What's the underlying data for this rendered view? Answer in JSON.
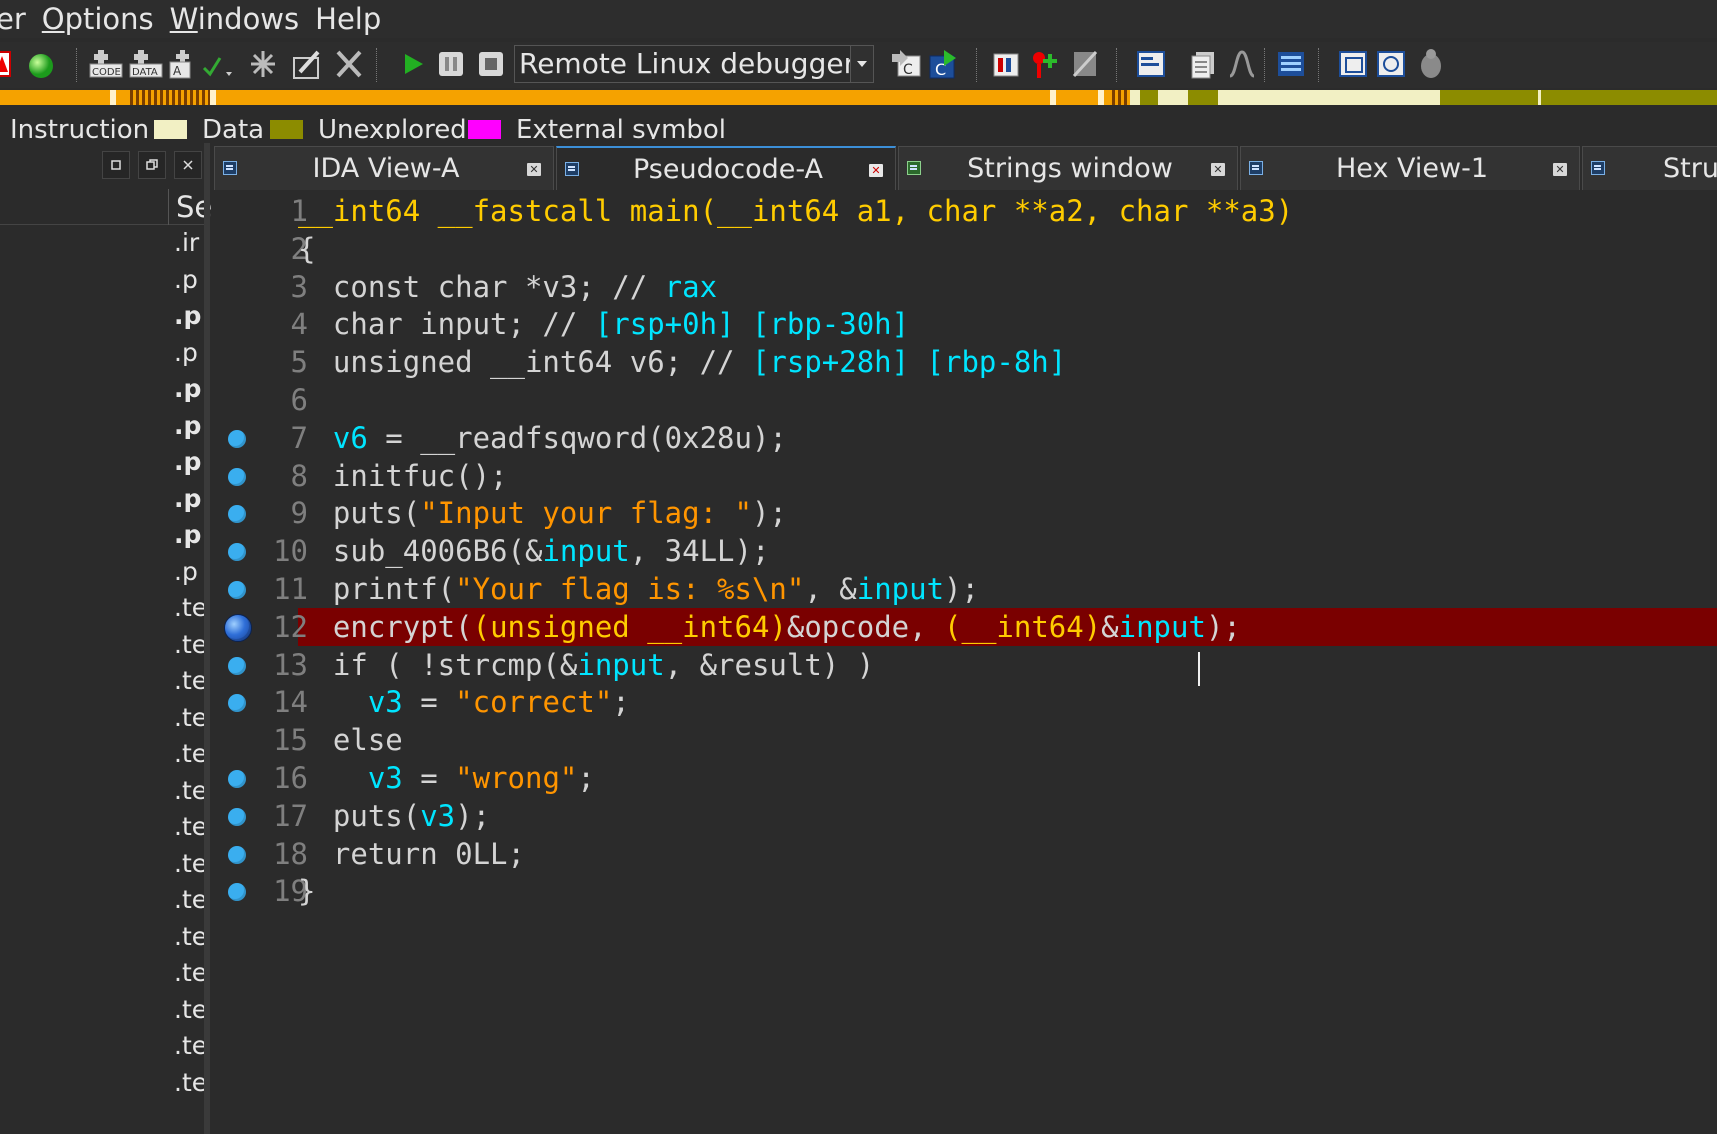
{
  "menu": [
    {
      "pre": "",
      "u": "",
      "post": "er"
    },
    {
      "pre": "",
      "u": "O",
      "post": "ptions"
    },
    {
      "pre": "",
      "u": "W",
      "post": "indows"
    },
    {
      "pre": "",
      "u": "",
      "post": "Help"
    }
  ],
  "toolbar": {
    "debugger_selected": "Remote Linux debugger"
  },
  "legend": {
    "items": [
      {
        "label": "Instruction",
        "color": ""
      },
      {
        "label": "Data",
        "color": "#f2f0c4"
      },
      {
        "label": "Unexplored",
        "color": "#8c8c00"
      },
      {
        "label": "External symbol",
        "color": "#ff00ff"
      }
    ]
  },
  "left_panel": {
    "column_header": "Se",
    "rows": [
      ".ir",
      ".p",
      ".p",
      ".p",
      ".p",
      ".p",
      ".p",
      ".p",
      ".p",
      ".p",
      ".te",
      ".te",
      ".te",
      ".te",
      ".te",
      ".te",
      ".te",
      ".te",
      ".te",
      ".te",
      ".te",
      ".te",
      ".te",
      ".te"
    ]
  },
  "tabs": [
    {
      "label": "IDA View-A",
      "active": false
    },
    {
      "label": "Pseudocode-A",
      "active": true
    },
    {
      "label": "Strings window",
      "active": false
    },
    {
      "label": "Hex View-1",
      "active": false
    },
    {
      "label": "Stru",
      "active": false
    }
  ],
  "colors": {
    "keyword": "#ffcc00",
    "variable": "#00e5ff",
    "string": "#ff9500",
    "highlight_line": "#7a0000",
    "breakpoint": "#3aaeef"
  },
  "code": {
    "current_line": 12,
    "lines": [
      {
        "n": "1",
        "bp": false,
        "tokens": [
          [
            "kw",
            "__int64 __fastcall main(__int64 a1, char **a2, char **a3)"
          ]
        ]
      },
      {
        "n": "2",
        "bp": false,
        "tokens": [
          [
            "plain",
            "{"
          ]
        ]
      },
      {
        "n": "3",
        "bp": false,
        "tokens": [
          [
            "plain",
            "  const char *v3; // "
          ],
          [
            "var",
            "rax"
          ]
        ]
      },
      {
        "n": "4",
        "bp": false,
        "tokens": [
          [
            "plain",
            "  char input; // "
          ],
          [
            "var",
            "[rsp+0h] [rbp-30h]"
          ]
        ]
      },
      {
        "n": "5",
        "bp": false,
        "tokens": [
          [
            "plain",
            "  unsigned __int64 v6; // "
          ],
          [
            "var",
            "[rsp+28h] [rbp-8h]"
          ]
        ]
      },
      {
        "n": "6",
        "bp": false,
        "tokens": []
      },
      {
        "n": "7",
        "bp": true,
        "tokens": [
          [
            "plain",
            "  "
          ],
          [
            "var",
            "v6"
          ],
          [
            "plain",
            " = __readfsqword(0x28u);"
          ]
        ]
      },
      {
        "n": "8",
        "bp": true,
        "tokens": [
          [
            "plain",
            "  initfuc();"
          ]
        ]
      },
      {
        "n": "9",
        "bp": true,
        "tokens": [
          [
            "plain",
            "  puts("
          ],
          [
            "str",
            "\"Input your flag: \""
          ],
          [
            "plain",
            ");"
          ]
        ]
      },
      {
        "n": "10",
        "bp": true,
        "tokens": [
          [
            "plain",
            "  sub_4006B6(&"
          ],
          [
            "var",
            "input"
          ],
          [
            "plain",
            ", 34LL);"
          ]
        ]
      },
      {
        "n": "11",
        "bp": true,
        "tokens": [
          [
            "plain",
            "  printf("
          ],
          [
            "str",
            "\"Your flag is: %s\\n\""
          ],
          [
            "plain",
            ", &"
          ],
          [
            "var",
            "input"
          ],
          [
            "plain",
            ");"
          ]
        ]
      },
      {
        "n": "12",
        "bp": true,
        "tokens": [
          [
            "plain",
            "  encrypt("
          ],
          [
            "kw",
            "(unsigned __int64)"
          ],
          [
            "plain",
            "&opcode, "
          ],
          [
            "kw",
            "(__int64)"
          ],
          [
            "plain",
            "&"
          ],
          [
            "var",
            "input"
          ],
          [
            "plain",
            ");"
          ]
        ]
      },
      {
        "n": "13",
        "bp": true,
        "tokens": [
          [
            "plain",
            "  if ( !strcmp(&"
          ],
          [
            "var",
            "input"
          ],
          [
            "plain",
            ", &result) )"
          ]
        ]
      },
      {
        "n": "14",
        "bp": true,
        "tokens": [
          [
            "plain",
            "    "
          ],
          [
            "var",
            "v3"
          ],
          [
            "plain",
            " = "
          ],
          [
            "str",
            "\"correct\""
          ],
          [
            "plain",
            ";"
          ]
        ]
      },
      {
        "n": "15",
        "bp": false,
        "tokens": [
          [
            "plain",
            "  else"
          ]
        ]
      },
      {
        "n": "16",
        "bp": true,
        "tokens": [
          [
            "plain",
            "    "
          ],
          [
            "var",
            "v3"
          ],
          [
            "plain",
            " = "
          ],
          [
            "str",
            "\"wrong\""
          ],
          [
            "plain",
            ";"
          ]
        ]
      },
      {
        "n": "17",
        "bp": true,
        "tokens": [
          [
            "plain",
            "  puts("
          ],
          [
            "var",
            "v3"
          ],
          [
            "plain",
            ");"
          ]
        ]
      },
      {
        "n": "18",
        "bp": true,
        "tokens": [
          [
            "plain",
            "  return 0LL;"
          ]
        ]
      },
      {
        "n": "19",
        "bp": true,
        "tokens": [
          [
            "plain",
            "}"
          ]
        ]
      }
    ]
  }
}
